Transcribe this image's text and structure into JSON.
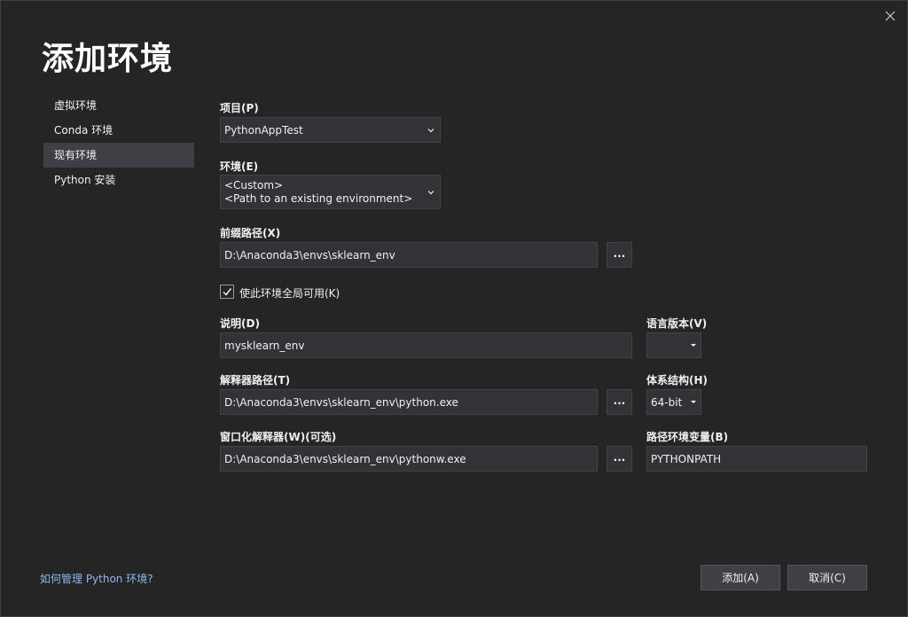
{
  "dialog": {
    "title": "添加环境",
    "close_icon": "close-icon"
  },
  "nav": {
    "items": [
      {
        "label": "虚拟环境",
        "active": false
      },
      {
        "label": "Conda 环境",
        "active": false
      },
      {
        "label": "现有环境",
        "active": true
      },
      {
        "label": "Python 安装",
        "active": false
      }
    ]
  },
  "form": {
    "project": {
      "label": "项目(P)",
      "value": "PythonAppTest"
    },
    "environment": {
      "label": "环境(E)",
      "line1": "<Custom>",
      "line2": "<Path to an existing environment>"
    },
    "prefix_path": {
      "label": "前缀路径(X)",
      "value": "D:\\Anaconda3\\envs\\sklearn_env",
      "browse": "..."
    },
    "make_global": {
      "label": "使此环境全局可用(K)",
      "checked": true
    },
    "description": {
      "label": "说明(D)",
      "value": "mysklearn_env"
    },
    "language_version": {
      "label": "语言版本(V)",
      "value": ""
    },
    "interpreter_path": {
      "label": "解释器路径(T)",
      "value": "D:\\Anaconda3\\envs\\sklearn_env\\python.exe",
      "browse": "..."
    },
    "architecture": {
      "label": "体系结构(H)",
      "value": "64-bit"
    },
    "windowed_interpreter": {
      "label": "窗口化解释器(W)(可选)",
      "value": "D:\\Anaconda3\\envs\\sklearn_env\\pythonw.exe",
      "browse": "..."
    },
    "path_env_var": {
      "label": "路径环境变量(B)",
      "value": "PYTHONPATH"
    }
  },
  "footer": {
    "help_link": "如何管理 Python 环境?",
    "add_button": "添加(A)",
    "cancel_button": "取消(C)"
  },
  "colors": {
    "background": "#252526",
    "field_bg": "#333337",
    "field_border": "#434346",
    "active_nav": "#3f3f46",
    "link": "#8fb7ee"
  }
}
